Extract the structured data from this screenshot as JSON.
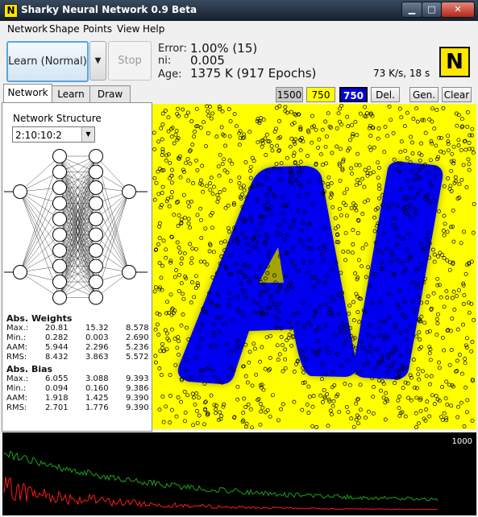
{
  "window": {
    "title": "Sharky Neural Network 0.9 Beta",
    "app_icon": "N",
    "minimize": "▁",
    "maximize": "□",
    "close": "✕"
  },
  "menu": [
    "Network",
    "Shape",
    "Points",
    "View",
    "Help"
  ],
  "toolbar": {
    "learn_label": "Learn (Normal)",
    "dropdown_glyph": "▼",
    "stop_label": "Stop"
  },
  "stats": {
    "error_label": "Error:",
    "error_value": "1.00% (15)",
    "ni_label": "ni:",
    "ni_value": "0.005",
    "age_label": "Age:",
    "age_value": "1375 K (917 Epochs)",
    "speed": "73 K/s, 18 s"
  },
  "logo": "N",
  "tabs": [
    "Network",
    "Learn",
    "Draw"
  ],
  "network_structure": {
    "label": "Network Structure",
    "value": "2:10:10:2"
  },
  "weights": {
    "title": "Abs. Weights",
    "rows": [
      {
        "label": "Max.:",
        "v": [
          "20.81",
          "15.32",
          "8.578"
        ]
      },
      {
        "label": "Min.:",
        "v": [
          "0.282",
          "0.003",
          "2.690"
        ]
      },
      {
        "label": "AAM:",
        "v": [
          "5.944",
          "2.296",
          "5.236"
        ]
      },
      {
        "label": "RMS:",
        "v": [
          "8.432",
          "3.863",
          "5.572"
        ]
      }
    ]
  },
  "bias": {
    "title": "Abs. Bias",
    "rows": [
      {
        "label": "Max.:",
        "v": [
          "6.055",
          "3.088",
          "9.393"
        ]
      },
      {
        "label": "Min.:",
        "v": [
          "0.094",
          "0.160",
          "9.386"
        ]
      },
      {
        "label": "AAM:",
        "v": [
          "1.918",
          "1.425",
          "9.390"
        ]
      },
      {
        "label": "RMS:",
        "v": [
          "2.701",
          "1.776",
          "9.390"
        ]
      }
    ]
  },
  "view_buttons": {
    "b1500": "1500",
    "b750y": "750",
    "b750b": "750",
    "del": "Del.",
    "gen": "Gen.",
    "clear": "Clear"
  },
  "chart_max_label": "1000",
  "colors": {
    "yellow": "#ffff00",
    "blue": "#0000ff",
    "green": "#1ea01e",
    "red": "#ff1a1a"
  }
}
